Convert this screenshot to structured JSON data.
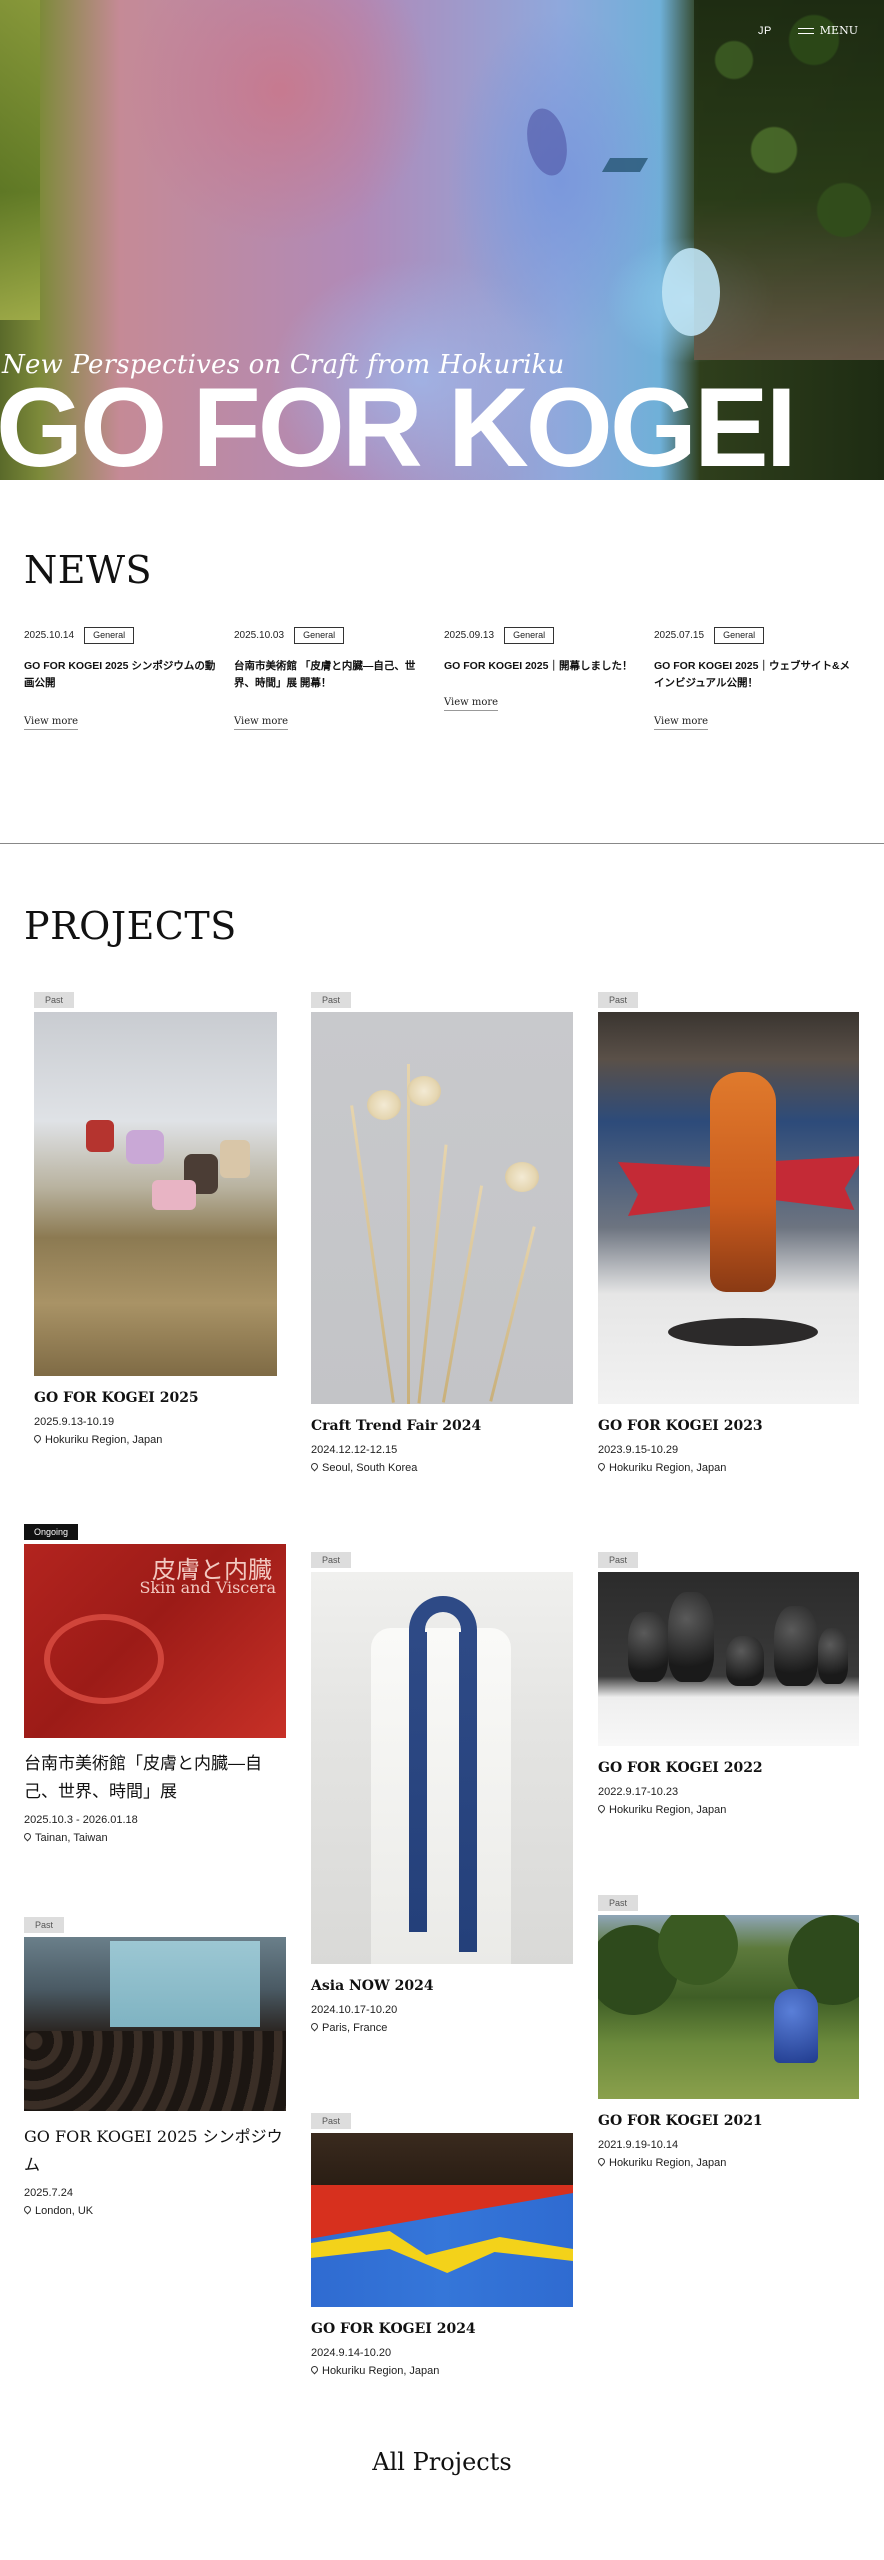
{
  "header": {
    "lang_label": "JP",
    "menu_label": "MENU"
  },
  "hero": {
    "tagline": "New Perspectives on Craft from Hokuriku",
    "title": "GO FOR KOGEI"
  },
  "news": {
    "title": "NEWS",
    "items": [
      {
        "date": "2025.10.14",
        "category": "General",
        "headline": "GO FOR KOGEI 2025 シンポジウムの動画公開",
        "more": "View more"
      },
      {
        "date": "2025.10.03",
        "category": "General",
        "headline": "台南市美術館 「皮膚と内臓―自己、世界、時間」展 開幕！",
        "more": "View more"
      },
      {
        "date": "2025.09.13",
        "category": "General",
        "headline": "GO FOR KOGEI 2025｜開幕しました！",
        "more": "View more"
      },
      {
        "date": "2025.07.15",
        "category": "General",
        "headline": "GO FOR KOGEI 2025｜ウェブサイト&メインビジュアル公開！",
        "more": "View more"
      }
    ]
  },
  "projects": {
    "title": "PROJECTS",
    "items": [
      {
        "status": "Past",
        "title": "GO FOR KOGEI 2025",
        "dates": "2025.9.13-10.19",
        "location": "Hokuriku Region, Japan"
      },
      {
        "status": "Past",
        "title": "Craft Trend Fair 2024",
        "dates": "2024.12.12-12.15",
        "location": "Seoul, South Korea"
      },
      {
        "status": "Past",
        "title": "GO FOR KOGEI 2023",
        "dates": "2023.9.15-10.29",
        "location": "Hokuriku Region, Japan"
      },
      {
        "status": "Ongoing",
        "title": "台南市美術館「皮膚と内臓―自己、世界、時間」展",
        "dates": "2025.10.3 - 2026.01.18",
        "location": "Tainan, Taiwan"
      },
      {
        "status": "Past",
        "title": "Asia NOW 2024",
        "dates": "2024.10.17-10.20",
        "location": "Paris, France"
      },
      {
        "status": "Past",
        "title": "GO FOR KOGEI 2022",
        "dates": "2022.9.17-10.23",
        "location": "Hokuriku Region, Japan"
      },
      {
        "status": "Past",
        "title": "GO FOR KOGEI 2025 シンポジウム",
        "dates": "2025.7.24",
        "location": "London, UK"
      },
      {
        "status": "Past",
        "title": "GO FOR KOGEI 2024",
        "dates": "2024.9.14-10.20",
        "location": "Hokuriku Region, Japan"
      },
      {
        "status": "Past",
        "title": "GO FOR KOGEI 2021",
        "dates": "2021.9.19-10.14",
        "location": "Hokuriku Region, Japan"
      }
    ],
    "poster": {
      "title_jp": "皮膚と内臓",
      "title_en": "Skin and Viscera"
    },
    "all_label": "All Projects"
  }
}
